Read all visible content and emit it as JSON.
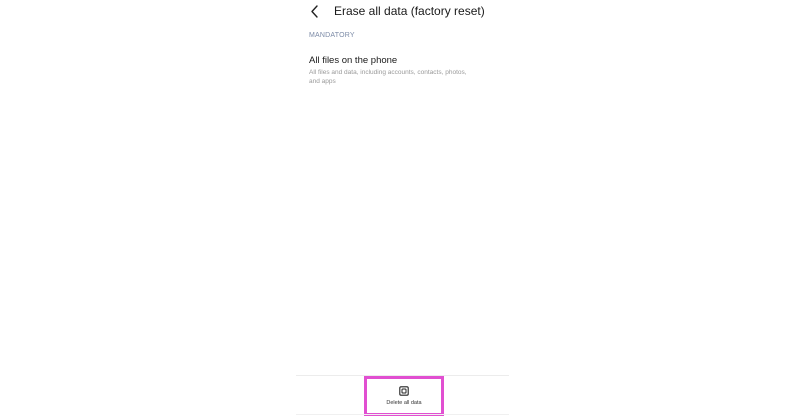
{
  "header": {
    "title": "Erase all data (factory reset)",
    "back_icon": "chevron-left-icon"
  },
  "section": {
    "label": "MANDATORY"
  },
  "item": {
    "title": "All files on the phone",
    "description": "All files and data, including accounts, contacts, photos, and apps"
  },
  "bottom_bar": {
    "delete_label": "Delete all data",
    "delete_icon": "erase-icon",
    "highlight_color": "#e14fd1"
  }
}
